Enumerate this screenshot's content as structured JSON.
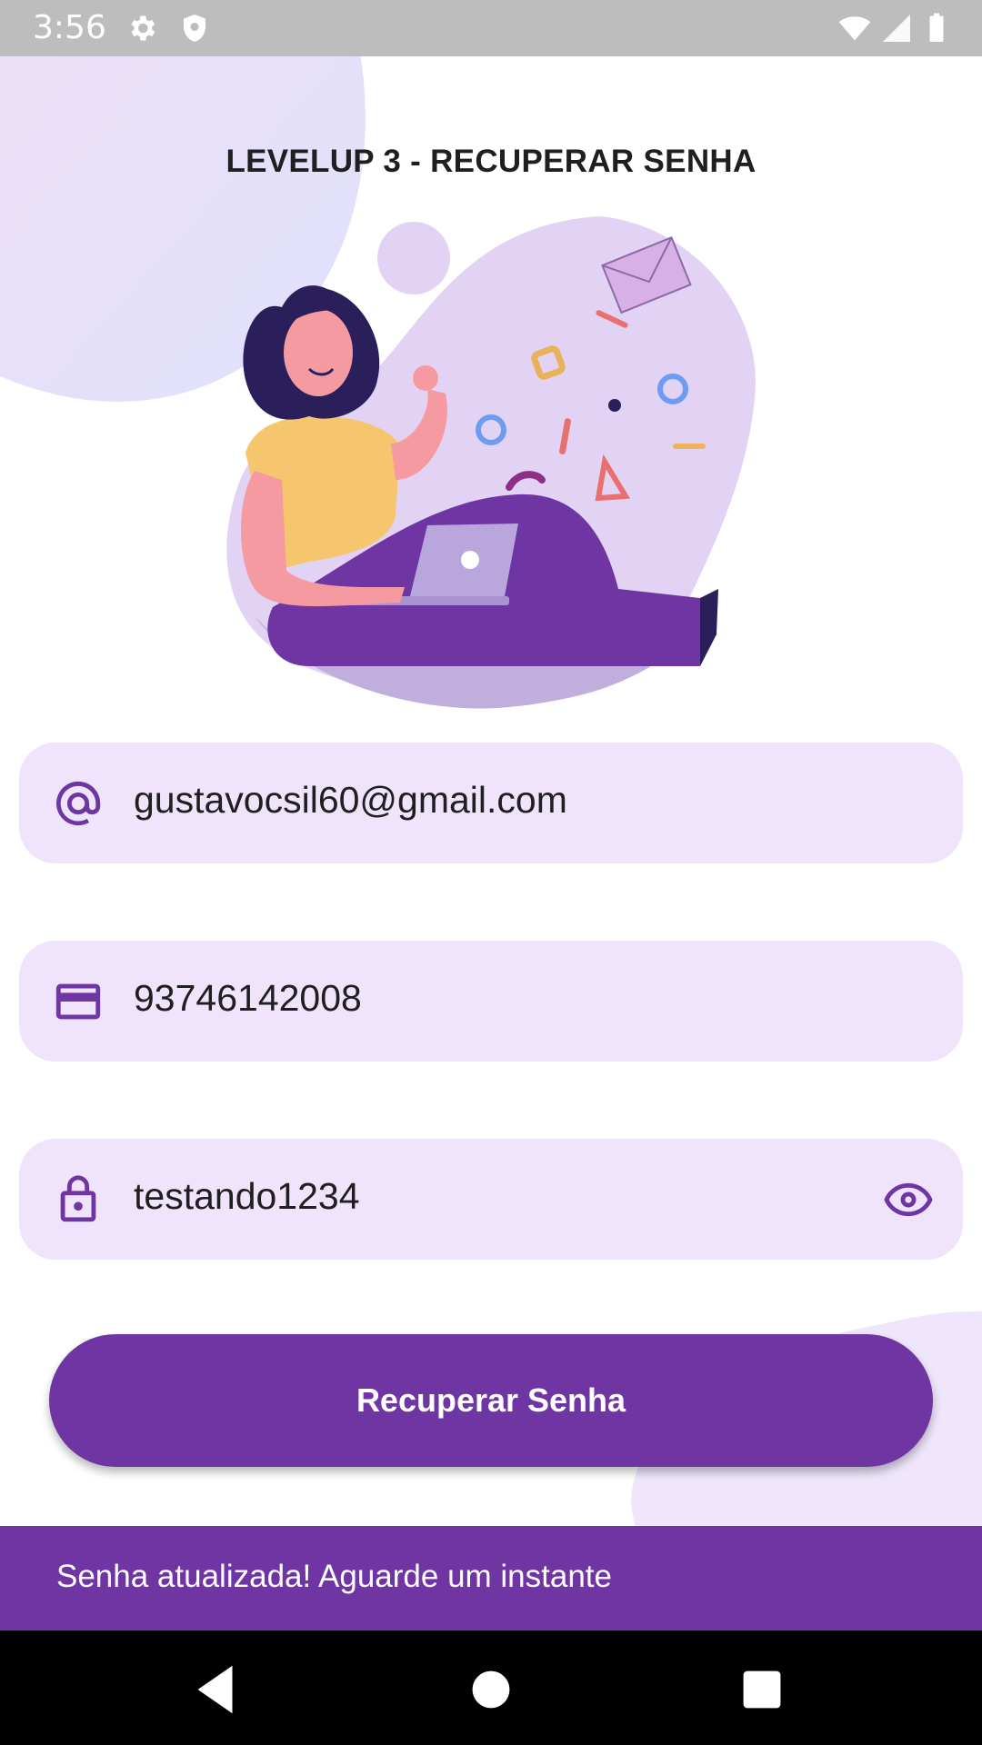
{
  "status_bar": {
    "time": "3:56"
  },
  "header": {
    "title": "LEVELUP 3 - RECUPERAR SENHA"
  },
  "form": {
    "email_value": "gustavocsil60@gmail.com",
    "cpf_value": "93746142008",
    "password_value": "testando1234",
    "submit_label": "Recuperar Senha"
  },
  "snackbar": {
    "message": "Senha atualizada! Aguarde um instante"
  },
  "icons": {
    "email": "at-icon",
    "cpf": "card-icon",
    "password": "lock-icon",
    "visibility": "eye-icon"
  },
  "colors": {
    "primary": "#6e35a3",
    "field_background": "#efe4fc",
    "status_bar": "#bdbdbd"
  }
}
